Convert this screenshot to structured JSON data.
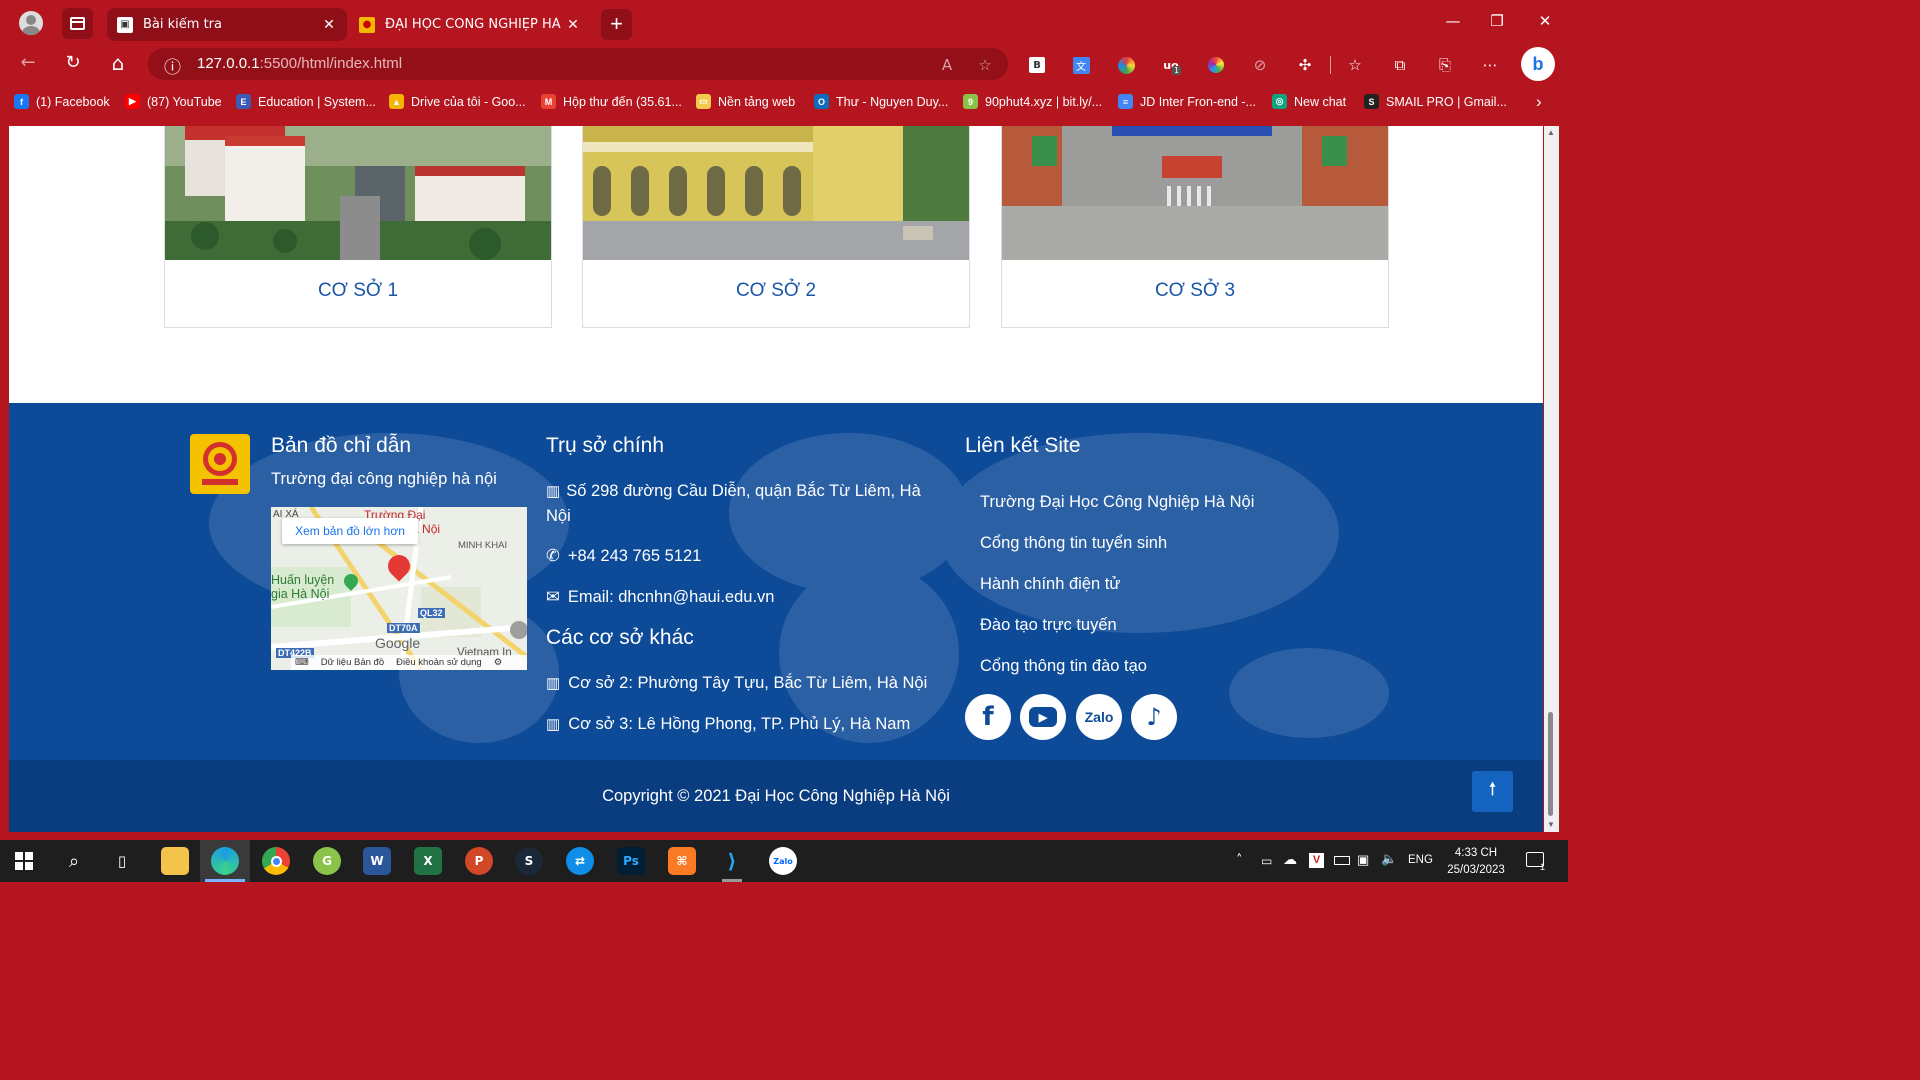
{
  "browser": {
    "tabs": [
      {
        "title": "Bài kiểm tra",
        "close": "✕"
      },
      {
        "title": "ĐẠI HỌC CÔNG NGHIỆP HÀ NỘI",
        "close": "✕"
      }
    ],
    "new_tab": "+",
    "window": {
      "minimize": "—",
      "restore": "❐",
      "close": "✕"
    },
    "address": {
      "url_host": "127.0.0.1",
      "url_rest": ":5500/html/index.html",
      "info_icon": "ⓘ"
    },
    "nav": {
      "back": "←",
      "reload": "↻",
      "home": "⌂"
    },
    "toolbar_icons": [
      "read-aloud-icon",
      "favorite-add-icon",
      "bookmark-b-icon",
      "translate-icon",
      "color-picker-icon",
      "ublock-icon",
      "color-wheel-icon",
      "compass-icon",
      "extensions-icon",
      "favorites-icon",
      "collections-icon",
      "share-icon",
      "more-icon",
      "bing-icon"
    ],
    "extension_badge": "1",
    "bookmarks": [
      {
        "label": "(1) Facebook",
        "icon": "f",
        "color": "#1877f2"
      },
      {
        "label": "(87) YouTube",
        "icon": "▶",
        "color": "#ff0000"
      },
      {
        "label": "Education | System...",
        "icon": "E",
        "color": "#3b5bb5"
      },
      {
        "label": "Drive của tôi - Goo...",
        "icon": "▲",
        "color": "#f4b400"
      },
      {
        "label": "Hộp thư đến (35.61...",
        "icon": "M",
        "color": "#ea4335"
      },
      {
        "label": "Nền tảng web",
        "icon": "▭",
        "color": "#f2c94c"
      },
      {
        "label": "Thư - Nguyen Duy...",
        "icon": "O",
        "color": "#0f6cbd"
      },
      {
        "label": "90phut4.xyz | bit.ly/...",
        "icon": "9",
        "color": "#8bc34a"
      },
      {
        "label": "JD Inter Fron-end -...",
        "icon": "≡",
        "color": "#4285f4"
      },
      {
        "label": "New chat",
        "icon": "◎",
        "color": "#10a37f"
      },
      {
        "label": "SMAIL PRO | Gmail...",
        "icon": "S",
        "color": "#222222"
      }
    ],
    "bookmarks_more": "›"
  },
  "campuses": [
    {
      "caption": "CƠ SỞ 1"
    },
    {
      "caption": "CƠ SỞ 2"
    },
    {
      "caption": "CƠ SỞ 3"
    }
  ],
  "footer": {
    "map_block": {
      "heading": "Bản đồ chỉ dẫn",
      "subheading": "Trường đại công nghiệp hà nội",
      "map_link": "Xem bản đồ lớn hơn",
      "map_labels": {
        "campus": "Trường Đại\nnghiệp Hà Nội",
        "area": "MINH KHAI",
        "training": "Huấn luyện\ngia Hà Nội",
        "road1": "QL32",
        "road2": "DT70A",
        "road3": "DT422B",
        "city": "Vietnam In",
        "corner": "AI XÁ",
        "google": "Google",
        "map_data": "Dữ liệu Bản đồ",
        "terms": "Điều khoản sử dụng"
      }
    },
    "head_office": {
      "heading": "Trụ sở chính",
      "address": "Số 298 đường Cầu Diễn, quận Bắc Từ Liêm, Hà Nội",
      "phone": "+84 243 765 5121",
      "email": "Email: dhcnhn@haui.edu.vn"
    },
    "other_campuses": {
      "heading": "Các cơ sở khác",
      "items": [
        "Cơ sở 2: Phường Tây Tựu, Bắc Từ Liêm, Hà Nội",
        "Cơ sở 3: Lê Hồng Phong, TP. Phủ Lý, Hà Nam"
      ]
    },
    "site_links": {
      "heading": "Liên kết Site",
      "items": [
        "Trường Đại Học Công Nghiệp Hà Nội",
        "Cổng thông tin tuyển sinh",
        "Hành chính điện tử",
        "Đào tạo trực tuyến",
        "Cổng thông tin đào tạo"
      ]
    },
    "social": [
      {
        "name": "facebook",
        "glyph": "f"
      },
      {
        "name": "youtube",
        "glyph": "▶"
      },
      {
        "name": "zalo",
        "glyph": "Zalo"
      },
      {
        "name": "tiktok",
        "glyph": "♪"
      }
    ],
    "copyright": "Copyright © 2021 Đại Học Công Nghiệp Hà Nội",
    "back_to_top": "🠕"
  },
  "taskbar": {
    "apps": [
      "start",
      "search",
      "task-view",
      "file-explorer",
      "edge-dev",
      "chrome",
      "greenshot",
      "word",
      "excel",
      "powerpoint",
      "steam",
      "teamviewer",
      "photoshop",
      "xampp",
      "vscode",
      "zalo"
    ],
    "lang": "ENG",
    "time": "4:33 CH",
    "date": "25/03/2023",
    "notification_count": "1"
  },
  "colors": {
    "browser_red": "#b5151f",
    "footer_blue": "#0d4a97",
    "copyright_blue": "#0a3d80",
    "campus_caption": "#1a56a6"
  }
}
